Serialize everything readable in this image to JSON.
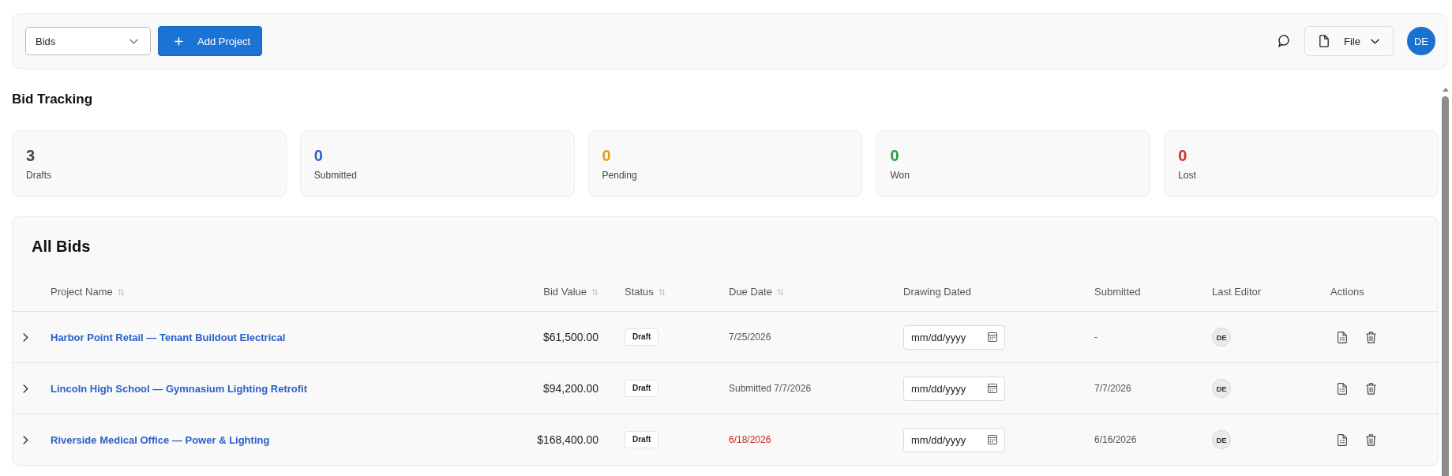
{
  "toolbar": {
    "view_select": {
      "value": "Bids"
    },
    "add_button": {
      "label": "Add Project"
    },
    "file_menu": {
      "label": "File"
    },
    "user_avatar": {
      "initials": "DE"
    }
  },
  "page_title": "Bid Tracking",
  "stats": [
    {
      "value": "3",
      "label": "Drafts",
      "color": "#444444"
    },
    {
      "value": "0",
      "label": "Submitted",
      "color": "#2a62d4"
    },
    {
      "value": "0",
      "label": "Pending",
      "color": "#e89b16"
    },
    {
      "value": "0",
      "label": "Won",
      "color": "#20a04a"
    },
    {
      "value": "0",
      "label": "Lost",
      "color": "#d32f2f"
    }
  ],
  "table": {
    "title": "All Bids",
    "columns": [
      {
        "label": "Project Name",
        "sortable": true
      },
      {
        "label": "Bid Value",
        "sortable": true
      },
      {
        "label": "Status",
        "sortable": true
      },
      {
        "label": "Due Date",
        "sortable": true
      },
      {
        "label": "Drawing Dated",
        "sortable": false
      },
      {
        "label": "Submitted",
        "sortable": false
      },
      {
        "label": "Last Editor",
        "sortable": false
      },
      {
        "label": "Actions",
        "sortable": false
      }
    ],
    "rows": [
      {
        "expanded": false,
        "project_name": "Harbor Point Retail — Tenant Buildout Electrical",
        "bid_value": "$61,500.00",
        "status": "Draft",
        "due_date": "7/25/2026",
        "overdue": false,
        "drawing_dated": {
          "placeholder": "mm/dd/yyyy"
        },
        "submitted": "-",
        "last_editor": "DE"
      },
      {
        "expanded": false,
        "project_name": "Lincoln High School — Gymnasium Lighting Retrofit",
        "bid_value": "$94,200.00",
        "status": "Draft",
        "due_date": "Submitted 7/7/2026",
        "overdue": false,
        "drawing_dated": {
          "placeholder": "mm/dd/yyyy"
        },
        "submitted": "7/7/2026",
        "last_editor": "DE"
      },
      {
        "expanded": false,
        "project_name": "Riverside Medical Office — Power & Lighting",
        "bid_value": "$168,400.00",
        "status": "Draft",
        "due_date": "6/18/2026",
        "overdue": true,
        "drawing_dated": {
          "placeholder": "mm/dd/yyyy"
        },
        "submitted": "6/16/2026",
        "last_editor": "DE"
      }
    ]
  }
}
